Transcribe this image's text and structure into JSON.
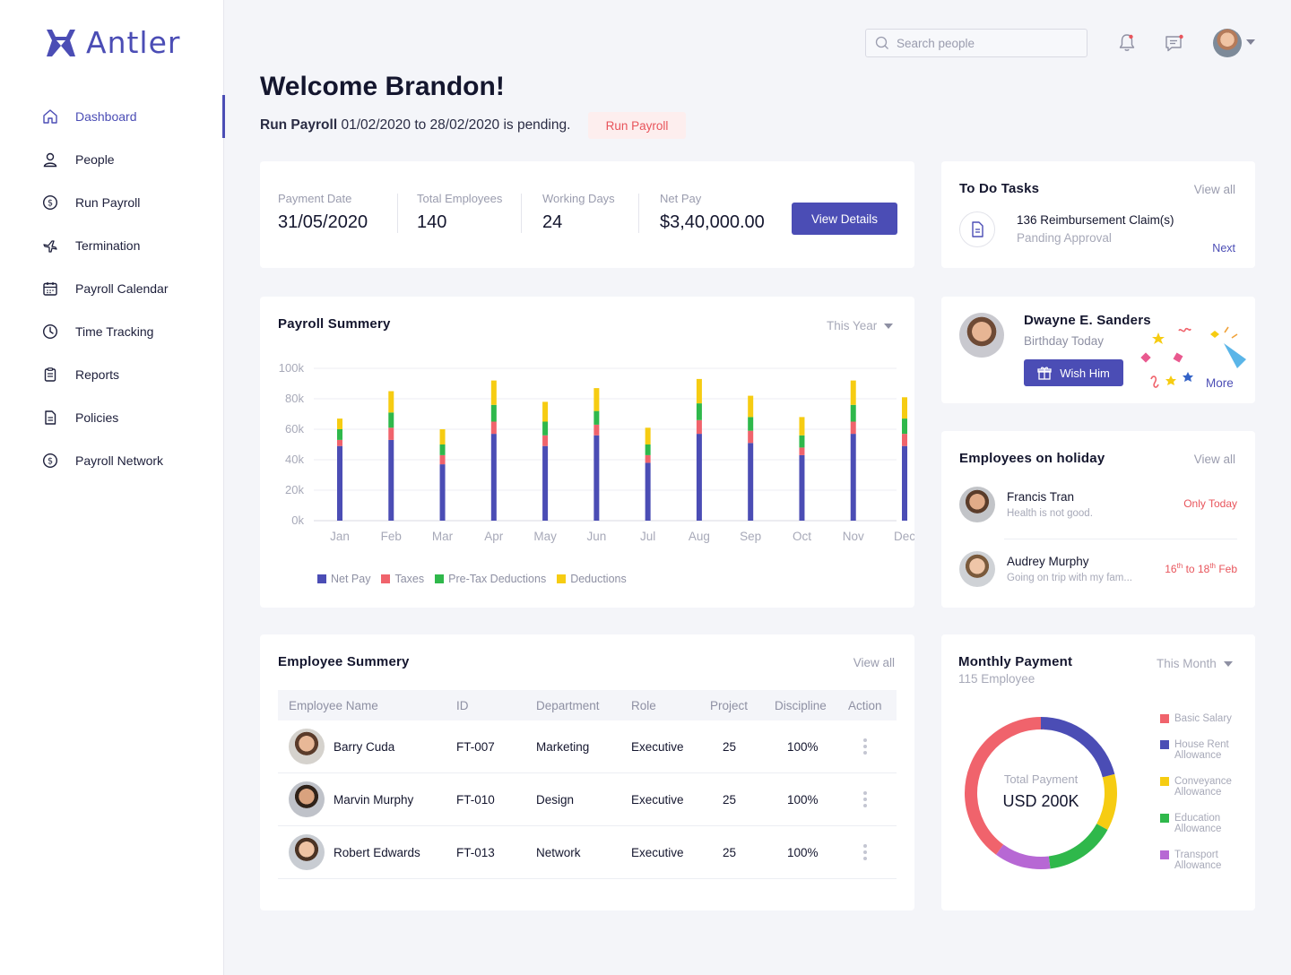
{
  "brand": {
    "name": "Antler",
    "color": "#4b4db5"
  },
  "sidebar": {
    "items": [
      {
        "label": "Dashboard",
        "icon": "home-icon",
        "active": true
      },
      {
        "label": "People",
        "icon": "user-icon"
      },
      {
        "label": "Run Payroll",
        "icon": "dollar-circle-icon"
      },
      {
        "label": "Termination",
        "icon": "plane-icon"
      },
      {
        "label": "Payroll Calendar",
        "icon": "calendar-icon"
      },
      {
        "label": "Time Tracking",
        "icon": "clock-icon"
      },
      {
        "label": "Reports",
        "icon": "clipboard-icon"
      },
      {
        "label": "Policies",
        "icon": "document-icon"
      },
      {
        "label": "Payroll Network",
        "icon": "dollar-circle-icon"
      }
    ]
  },
  "header": {
    "search_placeholder": "Search people",
    "icons": [
      "bell-icon",
      "message-icon"
    ],
    "status_color": "#e8545b"
  },
  "welcome": {
    "title": "Welcome Brandon!",
    "pending_bold": "Run Payroll",
    "pending_text": " 01/02/2020 to 28/02/2020 is pending.",
    "run_button": "Run Payroll"
  },
  "stats": {
    "payment_date_label": "Payment Date",
    "payment_date": "31/05/2020",
    "total_employees_label": "Total Employees",
    "total_employees": "140",
    "working_days_label": "Working Days",
    "working_days": "24",
    "net_pay_label": "Net Pay",
    "net_pay": "$3,40,000.00",
    "button": "View Details"
  },
  "payroll_summary": {
    "title": "Payroll Summery",
    "filter": "This Year"
  },
  "chart_data": {
    "type": "bar",
    "stacked": true,
    "categories": [
      "Jan",
      "Feb",
      "Mar",
      "Apr",
      "May",
      "Jun",
      "Jul",
      "Aug",
      "Sep",
      "Oct",
      "Nov",
      "Dec"
    ],
    "y_ticks": [
      "0k",
      "20k",
      "40k",
      "60k",
      "80k",
      "100k"
    ],
    "ylim": [
      0,
      100000
    ],
    "grid": true,
    "legend_position": "bottom-left",
    "series": [
      {
        "name": "Net Pay",
        "color": "#4b4db5",
        "values": [
          49000,
          53000,
          37000,
          57000,
          49000,
          56000,
          38000,
          57000,
          51000,
          43000,
          57000,
          49000
        ]
      },
      {
        "name": "Taxes",
        "color": "#f0636c",
        "values": [
          4000,
          8000,
          6000,
          8000,
          7000,
          7000,
          5000,
          9000,
          8000,
          5000,
          8000,
          8000
        ]
      },
      {
        "name": "Pre-Tax Deductions",
        "color": "#2fb84b",
        "values": [
          7000,
          10000,
          7000,
          11000,
          9000,
          9000,
          7000,
          11000,
          9000,
          8000,
          11000,
          10000
        ]
      },
      {
        "name": "Deductions",
        "color": "#f6cc12",
        "values": [
          7000,
          14000,
          10000,
          16000,
          13000,
          15000,
          11000,
          16000,
          14000,
          12000,
          16000,
          14000
        ]
      }
    ]
  },
  "employee_summary": {
    "title": "Employee Summery",
    "view_all": "View all",
    "columns": [
      "Employee Name",
      "ID",
      "Department",
      "Role",
      "Project",
      "Discipline",
      "Action"
    ],
    "rows": [
      {
        "name": "Barry Cuda",
        "id": "FT-007",
        "department": "Marketing",
        "role": "Executive",
        "project": "25",
        "discipline": "100%"
      },
      {
        "name": "Marvin Murphy",
        "id": "FT-010",
        "department": "Design",
        "role": "Executive",
        "project": "25",
        "discipline": "100%"
      },
      {
        "name": "Robert Edwards",
        "id": "FT-013",
        "department": "Network",
        "role": "Executive",
        "project": "25",
        "discipline": "100%"
      }
    ]
  },
  "todo": {
    "title": "To Do Tasks",
    "view_all": "View all",
    "item": "136 Reimbursement Claim(s)",
    "status": "Panding Approval",
    "next": "Next"
  },
  "birthday": {
    "name": "Dwayne E. Sanders",
    "sub": "Birthday Today",
    "button": "Wish Him",
    "more": "More"
  },
  "holiday": {
    "title": "Employees on holiday",
    "view_all": "View all",
    "rows": [
      {
        "name": "Francis Tran",
        "note": "Health is not good.",
        "when": "Only Today"
      },
      {
        "name": "Audrey Murphy",
        "note": "Going on trip with my fam...",
        "when_from": "16",
        "when_from_sup": "th",
        "when_to_word": " to ",
        "when_to": "18",
        "when_to_sup": "th",
        "when_month": " Feb"
      }
    ]
  },
  "monthly_payment": {
    "title": "Monthly Payment",
    "filter": "This Month",
    "sub": "115 Employee",
    "center_label": "Total Payment",
    "center_value": "USD 200K",
    "segments": [
      {
        "label": "Basic Salary",
        "color": "#f0636c",
        "share": 0.4
      },
      {
        "label": "House Rent Allowance",
        "color": "#4b4db5",
        "share": 0.21
      },
      {
        "label": "Conveyance Allowance",
        "color": "#f6cc12",
        "share": 0.12
      },
      {
        "label": "Education Allowance",
        "color": "#2fb84b",
        "share": 0.15
      },
      {
        "label": "Transport Allowance",
        "color": "#b768d4",
        "share": 0.12
      }
    ]
  }
}
